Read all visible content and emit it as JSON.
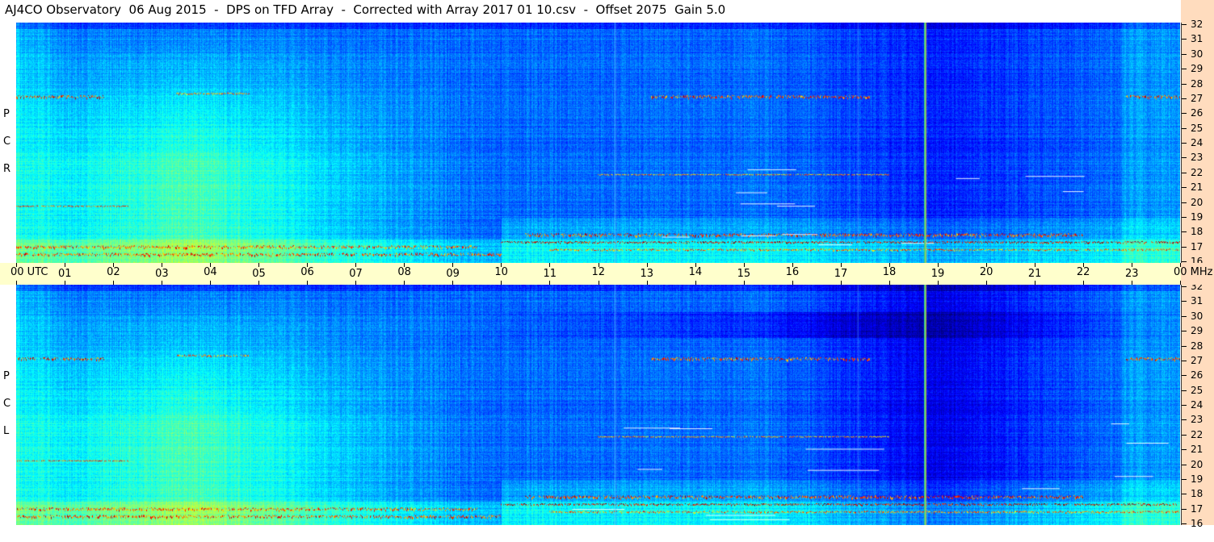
{
  "title": "AJ4CO Observatory  06 Aug 2015  -  DPS on TFD Array  -  Corrected with Array 2017 01 10.csv  -  Offset 2075  Gain 5.0",
  "top_panel": {
    "polarization_letters": [
      "P",
      "C",
      "R"
    ]
  },
  "bottom_panel": {
    "polarization_letters": [
      "P",
      "C",
      "L"
    ]
  },
  "time_axis": {
    "first_label": "00 UTC",
    "labels": [
      "01",
      "02",
      "03",
      "04",
      "05",
      "06",
      "07",
      "08",
      "09",
      "10",
      "11",
      "12",
      "13",
      "14",
      "15",
      "16",
      "17",
      "18",
      "19",
      "20",
      "21",
      "22",
      "23"
    ],
    "last_label": "00 MHz"
  },
  "colors": {
    "background": "#ffffff",
    "time_bar": "#ffffcc",
    "freq_axis_bg": "#ffdcbe"
  },
  "chart_data": {
    "type": "heatmap",
    "title": "AJ4CO Observatory  06 Aug 2015  -  DPS on TFD Array  -  Corrected with Array 2017 01 10.csv  -  Offset 2075  Gain 5.0",
    "x_axis": {
      "unit": "UTC",
      "range": [
        0,
        24
      ],
      "ticks": [
        0,
        1,
        2,
        3,
        4,
        5,
        6,
        7,
        8,
        9,
        10,
        11,
        12,
        13,
        14,
        15,
        16,
        17,
        18,
        19,
        20,
        21,
        22,
        23,
        24
      ]
    },
    "y_axis": {
      "unit": "MHz",
      "range": [
        16,
        32
      ],
      "ticks": [
        32,
        31,
        30,
        29,
        28,
        27,
        26,
        25,
        24,
        23,
        22,
        21,
        20,
        19,
        18,
        17,
        16
      ]
    },
    "panels": [
      {
        "polarization": "RCP"
      },
      {
        "polarization": "LCP"
      }
    ],
    "colormap": "jet"
  }
}
